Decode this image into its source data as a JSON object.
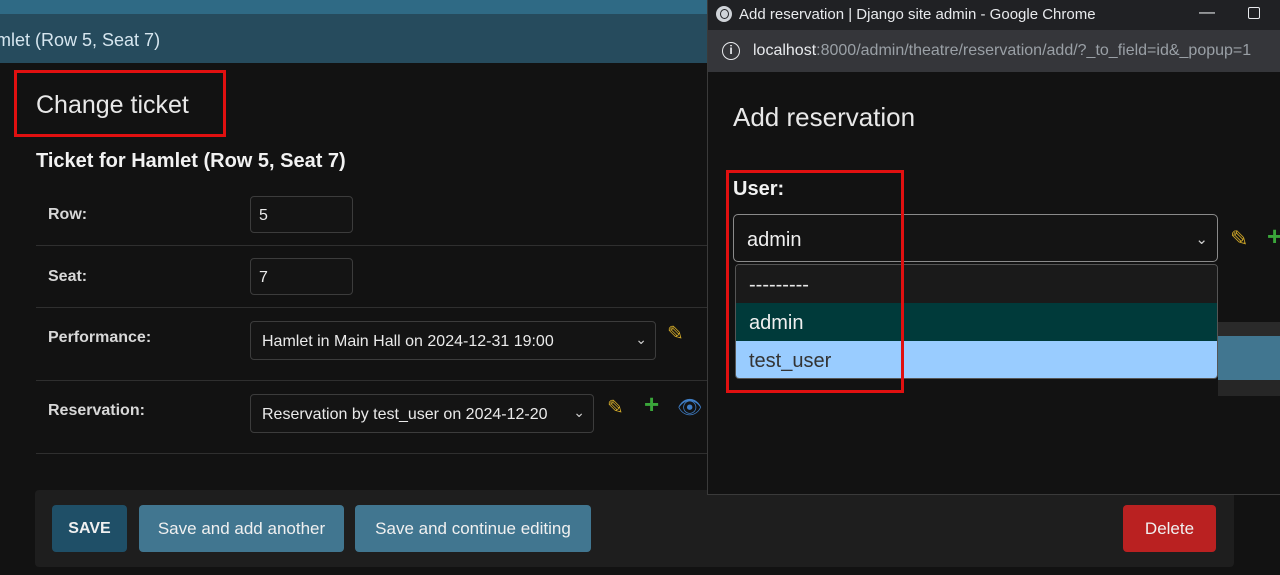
{
  "breadcrumb": {
    "text": "mlet (Row 5, Seat 7)"
  },
  "main": {
    "title": "Change ticket",
    "fieldset_title": "Ticket for Hamlet (Row 5, Seat 7)",
    "fields": {
      "row": {
        "label": "Row:",
        "value": "5"
      },
      "seat": {
        "label": "Seat:",
        "value": "7"
      },
      "performance": {
        "label": "Performance:",
        "value": "Hamlet in Main Hall on 2024-12-31 19:00"
      },
      "reservation": {
        "label": "Reservation:",
        "value": "Reservation by test_user on 2024-12-20"
      }
    },
    "icons": {
      "change": "pencil-icon",
      "add": "plus-icon",
      "view": "eye-icon"
    }
  },
  "submit_row": {
    "save": "SAVE",
    "save_add": "Save and add another",
    "save_continue": "Save and continue editing",
    "delete": "Delete"
  },
  "popup": {
    "window_title": "Add reservation | Django site admin - Google Chrome",
    "url_host": "localhost",
    "url_path": ":8000/admin/theatre/reservation/add/?_to_field=id&_popup=1",
    "heading": "Add reservation",
    "user_label": "User:",
    "user_selected": "admin",
    "user_options": [
      "---------",
      "admin",
      "test_user"
    ]
  },
  "colors": {
    "header_bar": "#264b5d",
    "button_primary": "#417690",
    "button_save": "#1f4f67",
    "button_delete": "#ba2121",
    "highlight_box": "#e01010"
  }
}
